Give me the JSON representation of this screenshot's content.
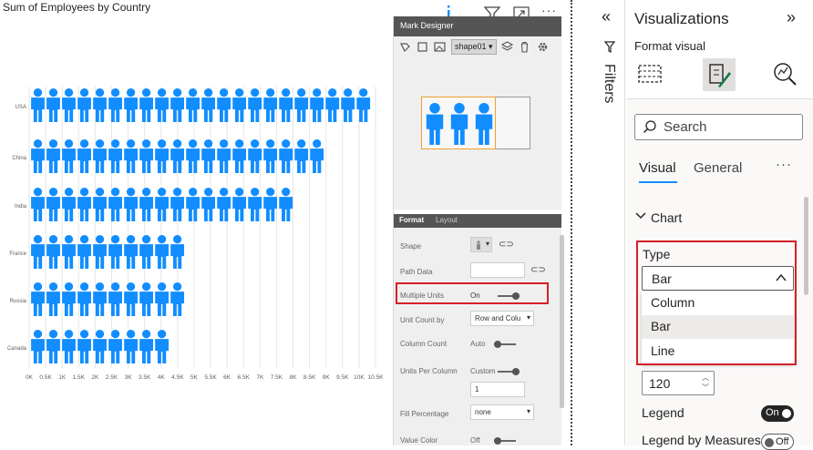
{
  "visual": {
    "title": "Sum of Employees by Country",
    "header_icons": [
      "info-icon",
      "filter-icon",
      "focus-mode-icon",
      "more-options-icon"
    ]
  },
  "chart_data": {
    "type": "bar",
    "categories": [
      "USA",
      "China",
      "India",
      "France",
      "Russia",
      "Canada"
    ],
    "values": [
      10500,
      9000,
      8000,
      4900,
      4800,
      4200
    ],
    "unit_per_icon": 470,
    "x_ticks": [
      "0K",
      "0.5K",
      "1K",
      "1.5K",
      "2K",
      "2.5K",
      "3K",
      "3.5K",
      "4K",
      "4.5K",
      "5K",
      "5.5K",
      "6K",
      "6.5K",
      "7K",
      "7.5K",
      "8K",
      "8.5K",
      "9K",
      "9.5K",
      "10K",
      "10.5K"
    ],
    "xlim": [
      0,
      10500
    ],
    "grid": true,
    "mark_color": "#118dff"
  },
  "mark_designer": {
    "title": "Mark Designer",
    "shape_select": "shape01",
    "tabs": [
      "Format",
      "Layout"
    ],
    "active_tab": "Format",
    "props": {
      "shape": "Shape",
      "path_data": "Path Data",
      "multiple_units": "Multiple Units",
      "multiple_units_val": "On",
      "unit_count_by": "Unit Count by",
      "unit_count_by_val": "Row and Colu",
      "column_count": "Column Count",
      "column_count_val": "Auto",
      "units_per_column": "Units Per Column",
      "units_per_column_val": "Custom",
      "units_per_column_num": "1",
      "fill_percentage": "Fill Percentage",
      "fill_percentage_val": "none",
      "value_color": "Value Color",
      "value_color_val": "Off"
    }
  },
  "filters": {
    "label": "Filters"
  },
  "viz": {
    "title": "Visualizations",
    "subtitle": "Format visual",
    "search_placeholder": "Search",
    "tabs": {
      "visual": "Visual",
      "general": "General",
      "more": "···"
    },
    "section": "Chart",
    "type_label": "Type",
    "type_value": "Bar",
    "type_options": [
      "Column",
      "Bar",
      "Line"
    ],
    "stepper_value": "120",
    "legend_label": "Legend",
    "legend_toggle": "On",
    "legend_measures_label": "Legend by Measures",
    "legend_measures_toggle": "Off",
    "accent_color": "#118dff",
    "highlight_color": "#d42028"
  }
}
